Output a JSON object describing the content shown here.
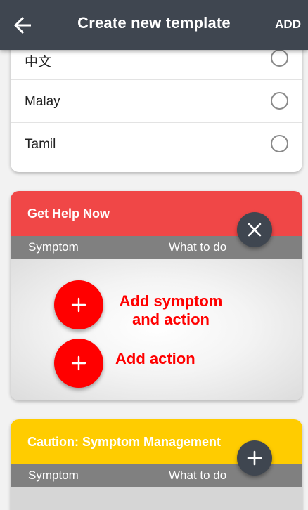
{
  "app_bar": {
    "title": "Create new template",
    "add_label": "ADD",
    "back_icon": "arrow-left-icon"
  },
  "languages": [
    {
      "label": "中文",
      "selected": false
    },
    {
      "label": "Malay",
      "selected": false
    },
    {
      "label": "Tamil",
      "selected": false
    }
  ],
  "get_help_card": {
    "title": "Get Help Now",
    "header_color": "#f04747",
    "col_symptom": "Symptom",
    "col_action": "What to do",
    "close_icon": "close-icon",
    "add_symptom_label": "Add symptom\nand action",
    "add_action_label": "Add action"
  },
  "caution_card": {
    "title": "Caution: Symptom Management",
    "header_color": "#ffcc00",
    "col_symptom": "Symptom",
    "col_action": "What to do",
    "expand_icon": "plus-icon"
  }
}
